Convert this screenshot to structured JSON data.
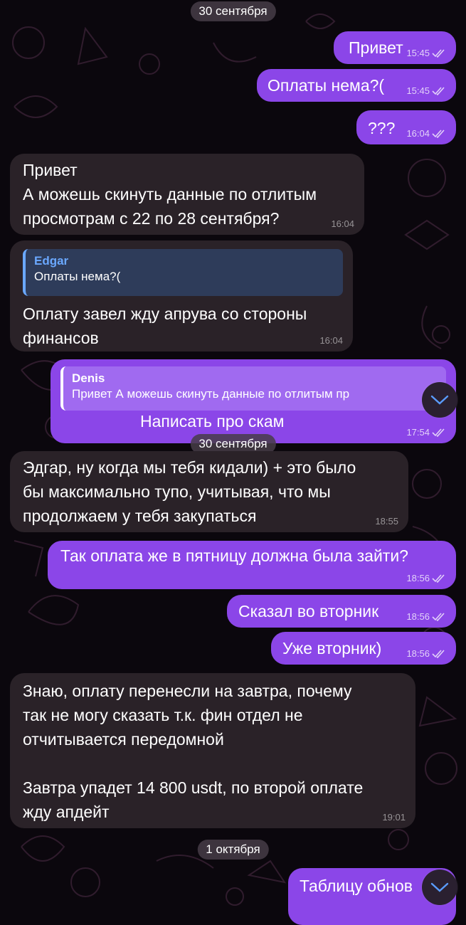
{
  "dates": {
    "top": "30 сентября",
    "middle": "30 сентября",
    "bottom": "1 октября"
  },
  "messages": [
    {
      "id": "m1",
      "dir": "out",
      "text": "Привет",
      "time": "15:45"
    },
    {
      "id": "m2",
      "dir": "out",
      "text": "Оплаты нема?(",
      "time": "15:45"
    },
    {
      "id": "m3",
      "dir": "out",
      "text": "???",
      "time": "16:04"
    },
    {
      "id": "m4",
      "dir": "in",
      "text": "Привет\nА можешь скинуть данные по отлитым\nпросмотрам с 22 по 28 сентября?",
      "time": "16:04"
    },
    {
      "id": "m5",
      "dir": "in",
      "reply_name": "Edgar",
      "reply_text": "Оплаты нема?(",
      "text": "Оплату завел жду апрува со стороны\nфинансов",
      "time": "16:04"
    },
    {
      "id": "m6",
      "dir": "out",
      "reply_name": "Denis",
      "reply_text": "Привет А можешь скинуть данные по отлитым пр",
      "text": "Написать про скам",
      "time": "17:54"
    },
    {
      "id": "m7",
      "dir": "in",
      "text": "Эдгар, ну когда мы тебя кидали) + это было\nбы максимально тупо, учитывая, что мы\nпродолжаем у тебя закупаться",
      "time": "18:55"
    },
    {
      "id": "m8",
      "dir": "out",
      "text": "Так оплата же в пятницу должна была зайти?",
      "time": "18:56"
    },
    {
      "id": "m9",
      "dir": "out",
      "text": "Сказал во вторник",
      "time": "18:56"
    },
    {
      "id": "m10",
      "dir": "out",
      "text": "Уже вторник)",
      "time": "18:56"
    },
    {
      "id": "m11",
      "dir": "in",
      "text": "Знаю, оплату перенесли на завтра, почему\nтак не могу сказать т.к. фин отдел не\nотчитывается передомной\n\nЗавтра упадет 14 800 usdt, по второй оплате\nжду апдейт",
      "time": "19:01"
    },
    {
      "id": "m12",
      "dir": "out",
      "text": "Таблицу обнов",
      "time": ""
    }
  ],
  "icons": {
    "read_receipt": "double-check-icon",
    "scroll_down": "chevron-down-icon"
  },
  "colors": {
    "background": "#0b070d",
    "outgoing_bubble": "#8b46e8",
    "incoming_bubble": "#2a2228",
    "reply_accent": "#6aa8ff"
  }
}
